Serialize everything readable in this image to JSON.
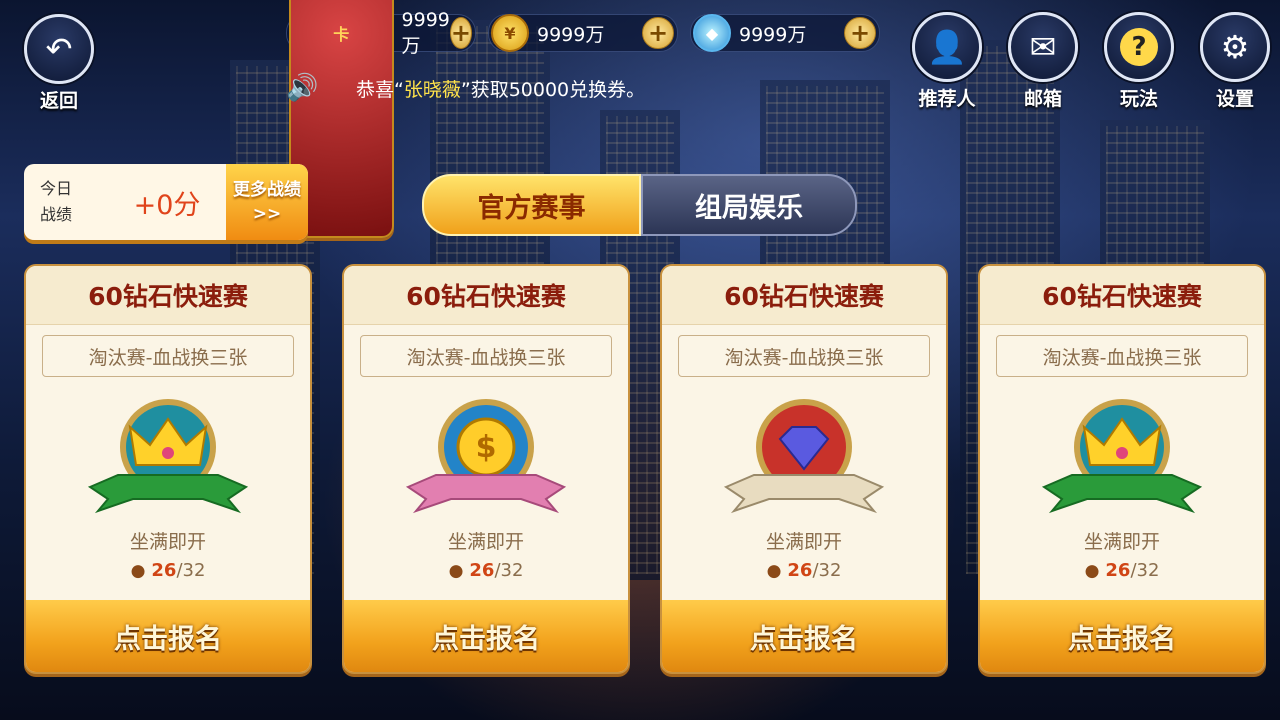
{
  "resources": [
    {
      "icon": "room-card-icon",
      "glyph": "卡",
      "value": "9999万",
      "plus": "+"
    },
    {
      "icon": "gold-coin-icon",
      "glyph": "¥",
      "value": "9999万",
      "plus": "+"
    },
    {
      "icon": "diamond-icon",
      "glyph": "◆",
      "value": "9999万",
      "plus": "+"
    }
  ],
  "nav": {
    "back_label": "返回",
    "referrer_label": "推荐人",
    "mailbox_label": "邮箱",
    "rules_label": "玩法",
    "settings_label": "设置"
  },
  "notice": {
    "prefix": "恭喜“",
    "name": "张晓薇",
    "suffix": "”获取50000兑换券。"
  },
  "score": {
    "label_line1": "今日",
    "label_line2": "战绩",
    "value": "+0分",
    "more_line1": "更多战绩",
    "more_line2": ">>"
  },
  "tabs": [
    {
      "label": "官方赛事",
      "active": true
    },
    {
      "label": "组局娱乐",
      "active": false
    }
  ],
  "cards": [
    {
      "title": "60钻石快速赛",
      "subtitle": "淘汰赛-血战换三张",
      "badge": "crown-badge-icon",
      "status": "坐满即开",
      "current": "26",
      "max": "/32",
      "button": "点击报名"
    },
    {
      "title": "60钻石快速赛",
      "subtitle": "淘汰赛-血战换三张",
      "badge": "coin-badge-icon",
      "status": "坐满即开",
      "current": "26",
      "max": "/32",
      "button": "点击报名"
    },
    {
      "title": "60钻石快速赛",
      "subtitle": "淘汰赛-血战换三张",
      "badge": "diamond-badge-icon",
      "status": "坐满即开",
      "current": "26",
      "max": "/32",
      "button": "点击报名"
    },
    {
      "title": "60钻石快速赛",
      "subtitle": "淘汰赛-血战换三张",
      "badge": "crown-badge-icon",
      "status": "坐满即开",
      "current": "26",
      "max": "/32",
      "button": "点击报名"
    }
  ],
  "colors": {
    "accent": "#f2a21c",
    "title": "#8b1d0c",
    "highlight": "#ffe34a",
    "count": "#d04515"
  }
}
